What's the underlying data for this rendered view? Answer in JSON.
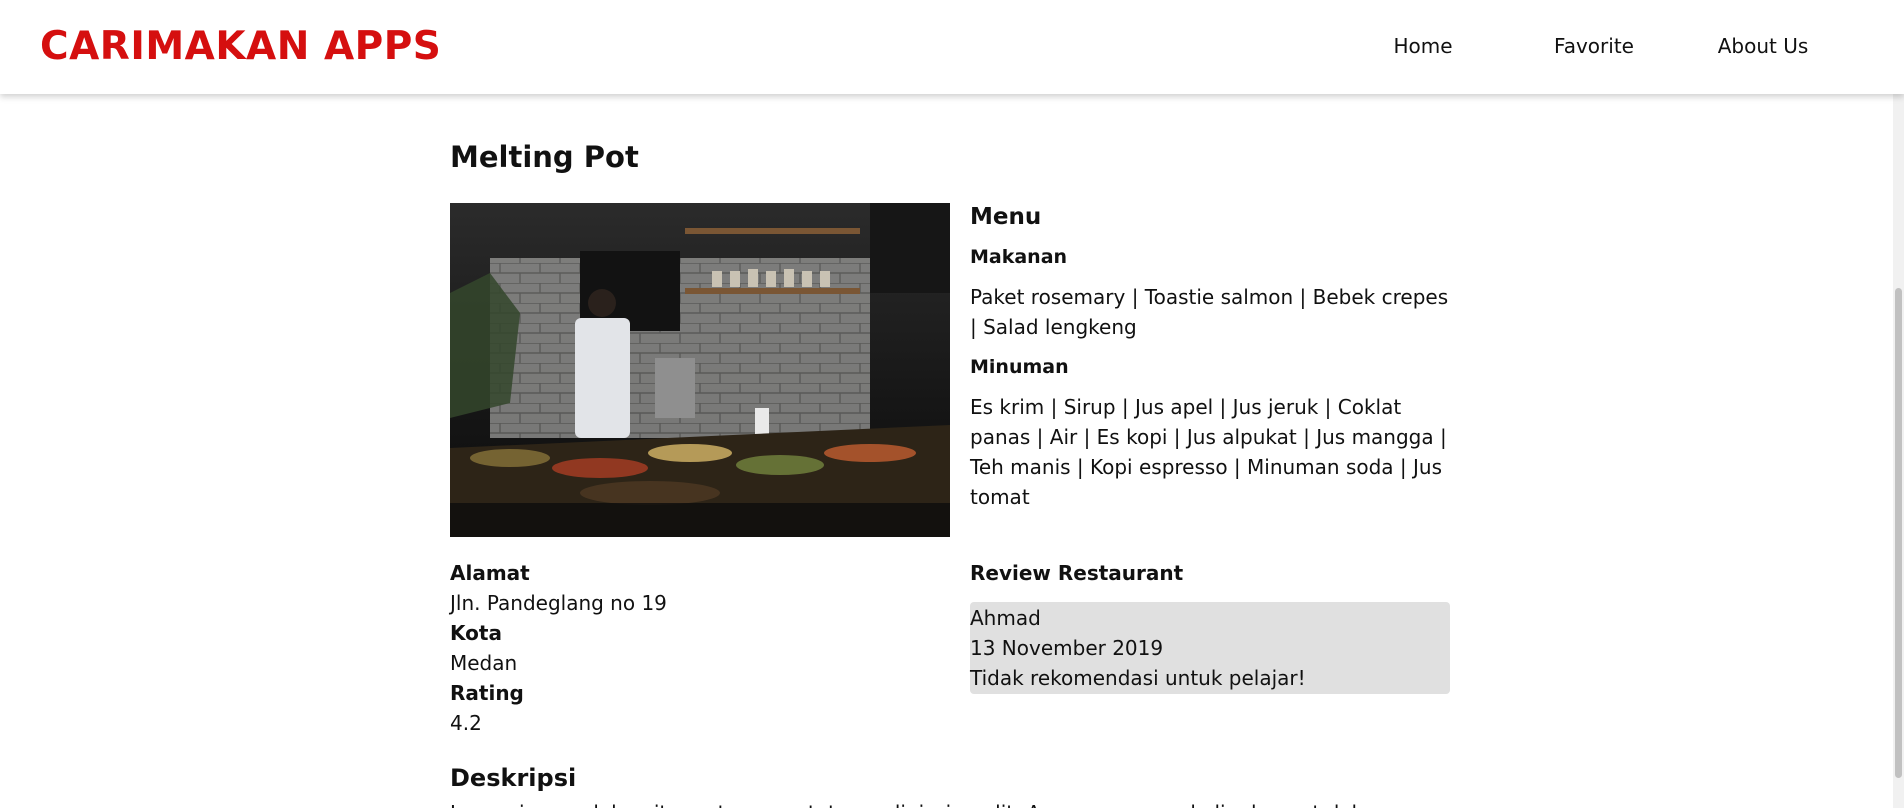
{
  "app": {
    "title": "CARIMAKAN APPS",
    "brand_color": "#d50f0f"
  },
  "nav": {
    "items": [
      {
        "label": "Home"
      },
      {
        "label": "Favorite"
      },
      {
        "label": "About Us"
      }
    ]
  },
  "restaurant": {
    "name": "Melting Pot",
    "menu": {
      "heading": "Menu",
      "foods_label": "Makanan",
      "foods": "Paket rosemary | Toastie salmon | Bebek crepes | Salad lengkeng",
      "drinks_label": "Minuman",
      "drinks": "Es krim | Sirup | Jus apel | Jus jeruk | Coklat panas | Air | Es kopi | Jus alpukat | Jus mangga | Teh manis | Kopi espresso | Minuman soda | Jus tomat"
    },
    "info": {
      "address_label": "Alamat",
      "address": "Jln. Pandeglang no 19",
      "city_label": "Kota",
      "city": "Medan",
      "rating_label": "Rating",
      "rating": "4.2"
    },
    "reviews": {
      "heading": "Review Restaurant",
      "items": [
        {
          "name": "Ahmad",
          "date": "13 November 2019",
          "review": "Tidak rekomendasi untuk pelajar!"
        }
      ]
    },
    "description": {
      "heading": "Deskripsi",
      "text": "Lorem ipsum dolor sit amet, consectetuer adipiscing elit. Aenean commodo ligula eget dolor."
    }
  },
  "colors": {
    "review_card_bg": "#e0e0e0",
    "text": "#111111"
  }
}
